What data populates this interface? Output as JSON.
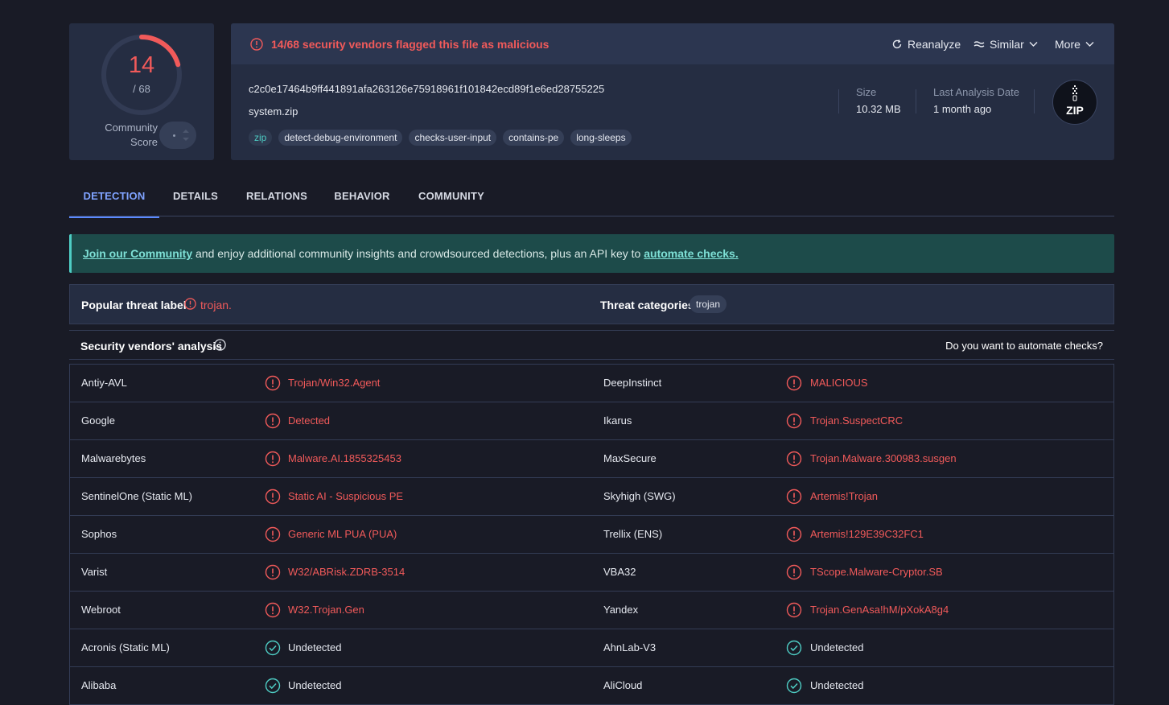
{
  "score": {
    "detections": "14",
    "total": "/ 68",
    "community_label": "Community Score"
  },
  "header": {
    "alert": "14/68 security vendors flagged this file as malicious",
    "reanalyze": "Reanalyze",
    "similar": "Similar",
    "more": "More",
    "hash": "c2c0e17464b9ff441891afa263126e75918961f101842ecd89f1e6ed28755225",
    "filename": "system.zip",
    "tags": [
      "zip",
      "detect-debug-environment",
      "checks-user-input",
      "contains-pe",
      "long-sleeps"
    ],
    "size_label": "Size",
    "size_value": "10.32 MB",
    "date_label": "Last Analysis Date",
    "date_value": "1 month ago",
    "file_type": "ZIP"
  },
  "tabs": [
    "DETECTION",
    "DETAILS",
    "RELATIONS",
    "BEHAVIOR",
    "COMMUNITY"
  ],
  "banner": {
    "link1": "Join our Community",
    "middle": " and enjoy additional community insights and crowdsourced detections, plus an API key to ",
    "link2": "automate checks."
  },
  "threat": {
    "label": "Popular threat label",
    "value": "trojan.",
    "categories_label": "Threat categories",
    "category": "trojan"
  },
  "vendors_section": {
    "title": "Security vendors' analysis",
    "automate": "Do you want to automate checks?"
  },
  "vendors": [
    {
      "left_name": "Antiy-AVL",
      "left_result": "Trojan/Win32.Agent",
      "left_status": "malicious",
      "right_name": "DeepInstinct",
      "right_result": "MALICIOUS",
      "right_status": "malicious"
    },
    {
      "left_name": "Google",
      "left_result": "Detected",
      "left_status": "malicious",
      "right_name": "Ikarus",
      "right_result": "Trojan.SuspectCRC",
      "right_status": "malicious"
    },
    {
      "left_name": "Malwarebytes",
      "left_result": "Malware.AI.1855325453",
      "left_status": "malicious",
      "right_name": "MaxSecure",
      "right_result": "Trojan.Malware.300983.susgen",
      "right_status": "malicious"
    },
    {
      "left_name": "SentinelOne (Static ML)",
      "left_result": "Static AI - Suspicious PE",
      "left_status": "malicious",
      "right_name": "Skyhigh (SWG)",
      "right_result": "Artemis!Trojan",
      "right_status": "malicious"
    },
    {
      "left_name": "Sophos",
      "left_result": "Generic ML PUA (PUA)",
      "left_status": "malicious",
      "right_name": "Trellix (ENS)",
      "right_result": "Artemis!129E39C32FC1",
      "right_status": "malicious"
    },
    {
      "left_name": "Varist",
      "left_result": "W32/ABRisk.ZDRB-3514",
      "left_status": "malicious",
      "right_name": "VBA32",
      "right_result": "TScope.Malware-Cryptor.SB",
      "right_status": "malicious"
    },
    {
      "left_name": "Webroot",
      "left_result": "W32.Trojan.Gen",
      "left_status": "malicious",
      "right_name": "Yandex",
      "right_result": "Trojan.GenAsa!hM/pXokA8g4",
      "right_status": "malicious"
    },
    {
      "left_name": "Acronis (Static ML)",
      "left_result": "Undetected",
      "left_status": "undetected",
      "right_name": "AhnLab-V3",
      "right_result": "Undetected",
      "right_status": "undetected"
    },
    {
      "left_name": "Alibaba",
      "left_result": "Undetected",
      "left_status": "undetected",
      "right_name": "AliCloud",
      "right_result": "Undetected",
      "right_status": "undetected"
    }
  ],
  "colors": {
    "malicious": "#f15a5a",
    "undetected": "#4ecdc4",
    "accent": "#5b8aff"
  }
}
